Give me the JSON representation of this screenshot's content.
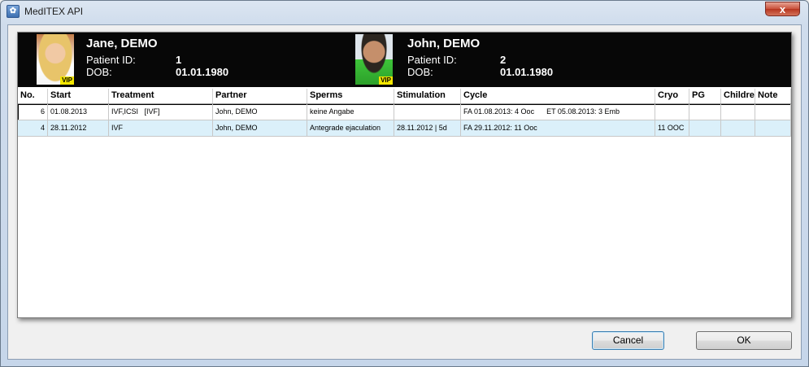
{
  "window": {
    "title": "MedITEX API",
    "close_glyph": "x",
    "app_icon": "meditex-app-icon"
  },
  "patients": [
    {
      "name": "Jane, DEMO",
      "id_label": "Patient ID:",
      "id": "1",
      "dob_label": "DOB:",
      "dob": "01.01.1980",
      "badge": "VIP",
      "photo": "female-patient-photo"
    },
    {
      "name": "John, DEMO",
      "id_label": "Patient ID:",
      "id": "2",
      "dob_label": "DOB:",
      "dob": "01.01.1980",
      "badge": "VIP",
      "photo": "male-patient-photo"
    }
  ],
  "table": {
    "columns": [
      "No.",
      "Start",
      "Treatment",
      "Partner",
      "Sperms",
      "Stimulation",
      "Cycle",
      "Cryo",
      "PG",
      "Children",
      "Note"
    ],
    "rows": [
      {
        "no": "6",
        "start": "01.08.2013",
        "treatment": "IVF,ICSI   [IVF]",
        "partner": "John, DEMO",
        "sperms": "keine Angabe",
        "stimulation": "",
        "cycle": "FA 01.08.2013: 4 Ooc      ET 05.08.2013: 3 Emb",
        "cryo": "",
        "pg": "",
        "children": "",
        "note": "",
        "selected": true
      },
      {
        "no": "4",
        "start": "28.11.2012",
        "treatment": "IVF",
        "partner": "John, DEMO",
        "sperms": "Antegrade ejaculation",
        "stimulation": "28.11.2012 | 5d",
        "cycle": "FA 29.11.2012: 11 Ooc",
        "cryo": "11 OOC",
        "pg": "",
        "children": "",
        "note": "",
        "selected": false
      }
    ]
  },
  "buttons": {
    "cancel": "Cancel",
    "ok": "OK"
  },
  "colors": {
    "header_bg": "#070707",
    "row_highlight": "#dbf0fa",
    "vip_badge": "#f3e600"
  }
}
